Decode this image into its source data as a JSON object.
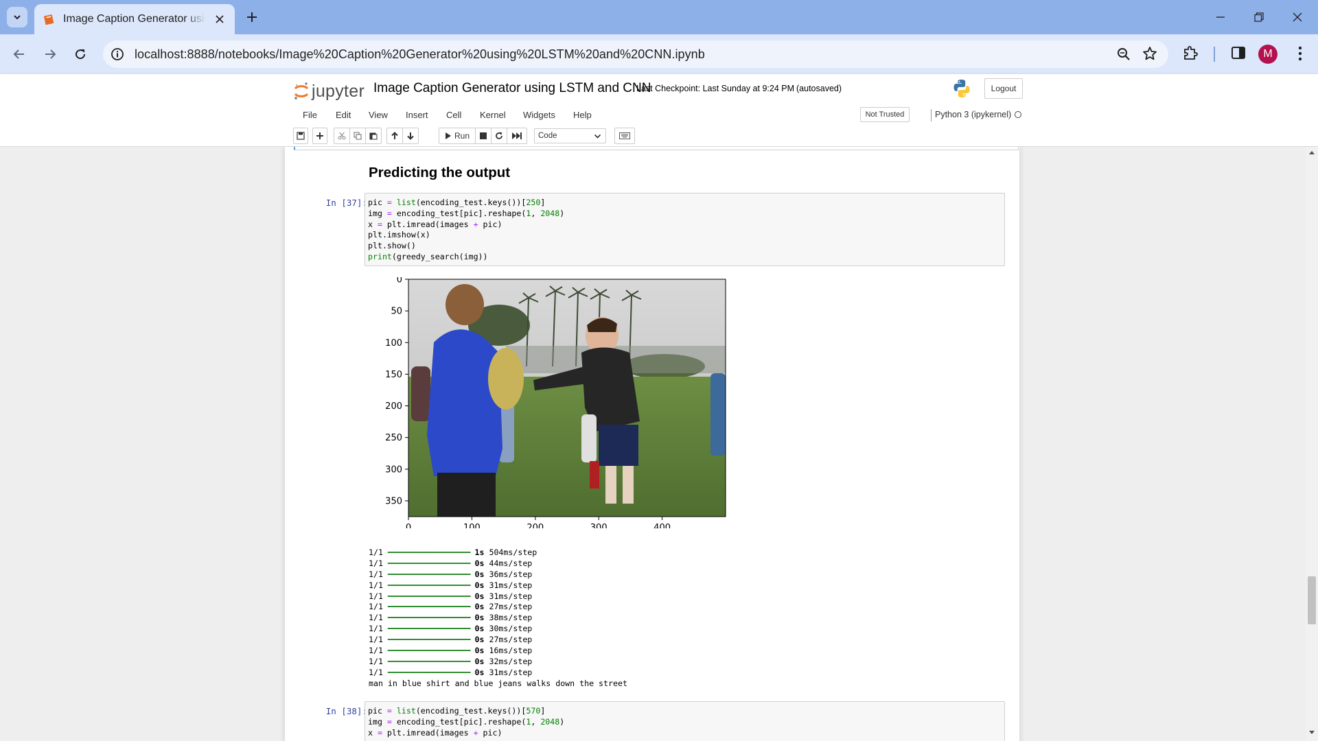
{
  "browser": {
    "tab_title": "Image Caption Generator using LSTM and CNN",
    "url": "localhost:8888/notebooks/Image%20Caption%20Generator%20using%20LSTM%20and%20CNN.ipynb",
    "avatar_letter": "M",
    "icons": [
      "tab-search-icon",
      "close-icon",
      "plus-icon",
      "minimize-icon",
      "restore-icon",
      "close-window-icon",
      "back-icon",
      "forward-icon",
      "reload-icon",
      "site-info-icon",
      "zoom-icon",
      "star-icon",
      "extensions-icon",
      "side-panel-icon",
      "menu-icon"
    ],
    "tab_bar_color": "#8eb0e9",
    "toolbar_color": "#dce7fb"
  },
  "jupyter": {
    "logo_text": "jupyter",
    "notebook_name": "Image Caption Generator using LSTM and CNN",
    "checkpoint": "Last Checkpoint: Last Sunday at 9:24 PM",
    "autosave": "(autosaved)",
    "logout": "Logout",
    "menu": [
      "File",
      "Edit",
      "View",
      "Insert",
      "Cell",
      "Kernel",
      "Widgets",
      "Help"
    ],
    "trust": "Not Trusted",
    "kernel": "Python 3 (ipykernel)",
    "toolbar": {
      "run_label": "Run",
      "cell_type": "Code",
      "icons": [
        "save-icon",
        "insert-cell-icon",
        "cut-icon",
        "copy-icon",
        "paste-icon",
        "move-up-icon",
        "move-down-icon",
        "run-icon",
        "interrupt-icon",
        "restart-icon",
        "run-all-icon",
        "keyboard-icon"
      ]
    }
  },
  "notebook": {
    "heading": "Predicting the output",
    "cells": [
      {
        "prompt": "In [37]:",
        "code": [
          "pic = list(encoding_test.keys())[250]",
          "img = encoding_test[pic].reshape(1, 2048)",
          "x = plt.imread(images + pic)",
          "plt.imshow(x)",
          "plt.show()",
          "print(greedy_search(img))"
        ],
        "output": {
          "image_plot": {
            "x_ticks": [
              "0",
              "100",
              "200",
              "300",
              "400"
            ],
            "y_ticks": [
              "0",
              "50",
              "100",
              "150",
              "200",
              "250",
              "300",
              "350"
            ],
            "x_range": [
              0,
              500
            ],
            "y_range": [
              0,
              375
            ],
            "image_description": "photo"
          },
          "progress_lines": [
            {
              "step": "1/1",
              "time": "1s",
              "rate": "504ms/step"
            },
            {
              "step": "1/1",
              "time": "0s",
              "rate": "44ms/step"
            },
            {
              "step": "1/1",
              "time": "0s",
              "rate": "36ms/step"
            },
            {
              "step": "1/1",
              "time": "0s",
              "rate": "31ms/step"
            },
            {
              "step": "1/1",
              "time": "0s",
              "rate": "31ms/step"
            },
            {
              "step": "1/1",
              "time": "0s",
              "rate": "27ms/step"
            },
            {
              "step": "1/1",
              "time": "0s",
              "rate": "38ms/step"
            },
            {
              "step": "1/1",
              "time": "0s",
              "rate": "30ms/step"
            },
            {
              "step": "1/1",
              "time": "0s",
              "rate": "27ms/step"
            },
            {
              "step": "1/1",
              "time": "0s",
              "rate": "16ms/step"
            },
            {
              "step": "1/1",
              "time": "0s",
              "rate": "32ms/step"
            },
            {
              "step": "1/1",
              "time": "0s",
              "rate": "31ms/step"
            }
          ],
          "progress_bar": "━━━━━━━━━━━━━━━━━━━━",
          "caption": "man in blue shirt and blue jeans walks down the street"
        }
      },
      {
        "prompt": "In [38]:",
        "code": [
          "pic = list(encoding_test.keys())[570]",
          "img = encoding_test[pic].reshape(1, 2048)",
          "x = plt.imread(images + pic)"
        ]
      }
    ]
  }
}
